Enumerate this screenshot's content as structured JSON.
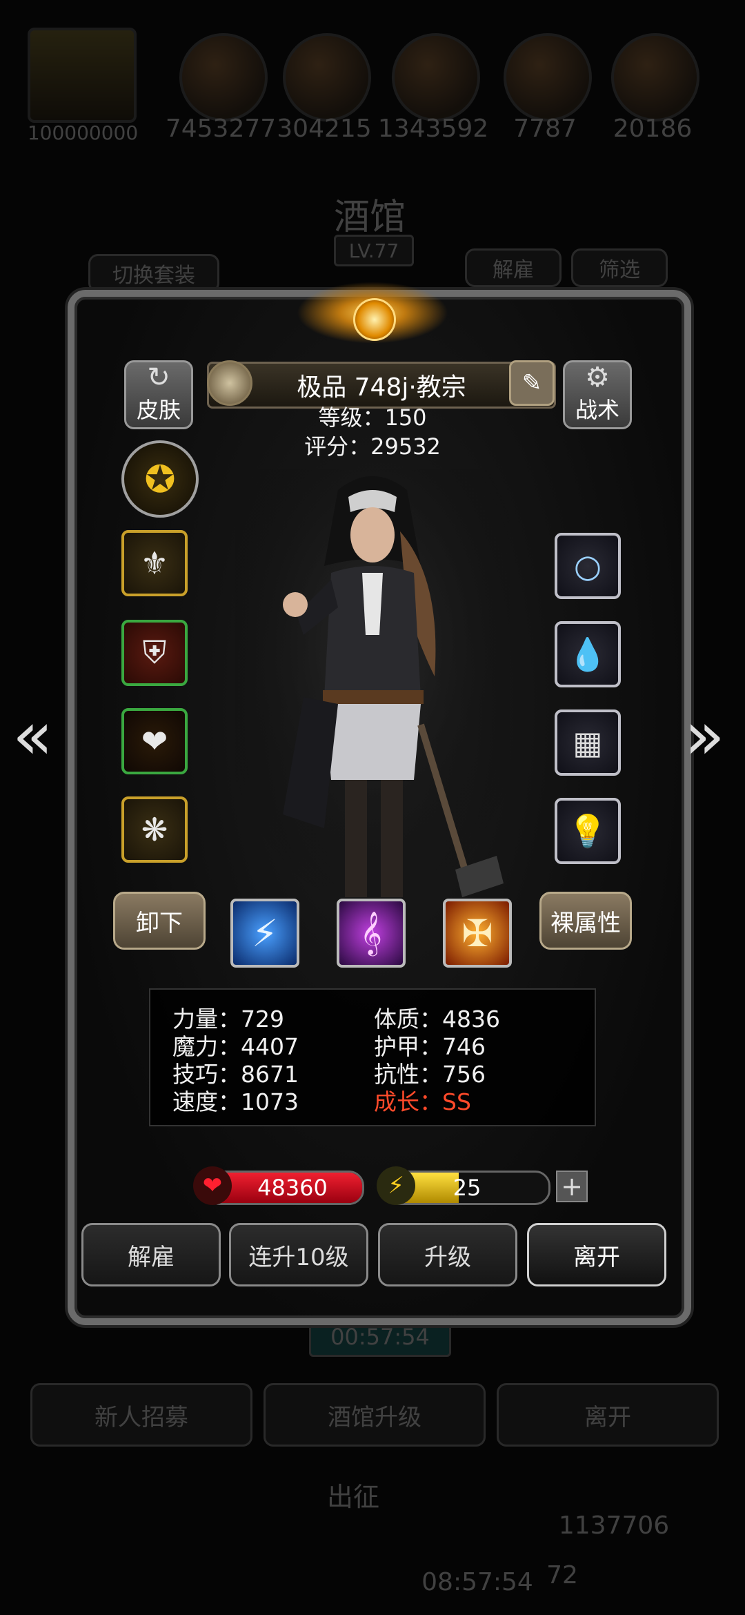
{
  "background": {
    "resources": [
      "100000000",
      "7453277",
      "304215",
      "1343592",
      "7787",
      "20186"
    ],
    "title": "酒馆",
    "level": "LV.77",
    "switch_outfit": "切换套装",
    "dismiss": "解雇",
    "filter": "筛选",
    "timer": "00:57:54",
    "buttons": [
      "新人招募",
      "酒馆升级",
      "离开"
    ],
    "expedition": "出征",
    "bottom_value": "1137706",
    "bottom_small": "72",
    "bottom_timer": "08:57:54"
  },
  "hero": {
    "name": "极品 748j·教宗",
    "level_line": "等级：150",
    "score_line": "评分：29532"
  },
  "side_buttons": {
    "skin": "皮肤",
    "tactics": "战术",
    "unequip": "卸下",
    "raw_attributes": "裸属性"
  },
  "icons": {
    "skin": "refresh-icon",
    "tactics": "gear-icon",
    "badge": "emblem-icon",
    "left_slots": [
      "staff-icon",
      "armor-icon",
      "amulet-icon",
      "medallion-icon"
    ],
    "right_slots": [
      "halo-icon",
      "water-drop-icon",
      "mesh-icon",
      "lantern-icon"
    ],
    "skills": [
      "lightning-skill-icon",
      "note-skill-icon",
      "holy-shield-skill-icon"
    ]
  },
  "stats": {
    "strength": "力量：729",
    "constitution": "体质：4836",
    "magic": "魔力：4407",
    "armor": "护甲：746",
    "skill": "技巧：8671",
    "resistance": "抗性：756",
    "speed": "速度：1073",
    "growth": "成长：SS"
  },
  "bars": {
    "hp": "48360",
    "energy": "25",
    "energy_fraction": 0.45
  },
  "actions": [
    "解雇",
    "连升10级",
    "升级",
    "离开"
  ],
  "colors": {
    "growth": "#ff4a2a",
    "hp_bar": "#d0101a",
    "energy_bar": "#e8c020",
    "gold_frame": "#c9a02a",
    "green_frame": "#3aa840"
  }
}
